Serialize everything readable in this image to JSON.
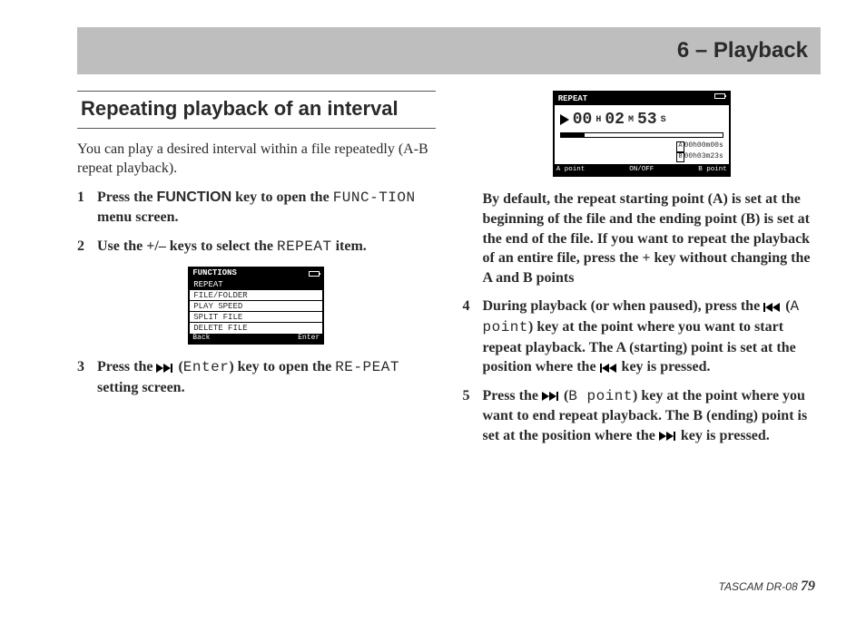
{
  "header": {
    "chapter": "6 – Playback"
  },
  "section_title": "Repeating playback of an interval",
  "intro": "You can play a desired interval within a file repeatedly (A-B repeat playback).",
  "steps": {
    "s1_a": "Press the ",
    "s1_func": "FUNCTION",
    "s1_b": " key to open the ",
    "s1_mono": "FUNC-TION",
    "s1_c": " menu screen.",
    "s2_a": "Use the +/– keys to select the ",
    "s2_mono": "REPEAT",
    "s2_b": " item.",
    "s3_a": "Press the ",
    "s3_mono1": "Enter",
    "s3_b": ") key to open the ",
    "s3_mono2": "RE-PEAT",
    "s3_c": " setting screen.",
    "note": "By default, the repeat starting point (A) is set at the beginning of the file and the ending point (B) is set at the end of the file. If you want to repeat the playback of an entire file, press the + key without changing the A and B points",
    "s4_a": "During playback (or when paused), press the ",
    "s4_mono": "A point",
    "s4_b": ") key at the point where you want to start repeat playback. The A (starting) point is set at the position where the ",
    "s4_c": " key is pressed.",
    "s5_a": "Press the ",
    "s5_mono": "B point",
    "s5_b": ") key at the point where you want to end repeat playback. The B (ending) point is set at the position where the ",
    "s5_c": " key is pressed."
  },
  "lcdA": {
    "title": "FUNCTIONS",
    "rows": [
      "REPEAT",
      "FILE/FOLDER",
      "PLAY SPEED",
      "SPLIT FILE",
      "DELETE FILE"
    ],
    "foot_left": "Back",
    "foot_right": "Enter"
  },
  "lcdB": {
    "title": "REPEAT",
    "time_h": "00",
    "time_m": "02",
    "time_s": "53",
    "a_time": "00h00m00s",
    "b_time": "00h03m23s",
    "foot_left": "A point",
    "foot_mid": "ON/OFF",
    "foot_right": "B point"
  },
  "footer": {
    "model": "TASCAM  DR-08 ",
    "page": "79"
  }
}
